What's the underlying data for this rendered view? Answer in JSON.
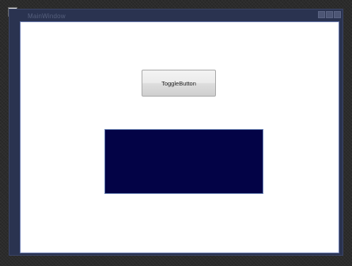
{
  "window": {
    "title": "MainWindow"
  },
  "toggle_button": {
    "label": "ToggleButton"
  },
  "rectangle": {
    "fill_color": "#030346"
  },
  "icons": {
    "designer": "window-designer-icon"
  }
}
